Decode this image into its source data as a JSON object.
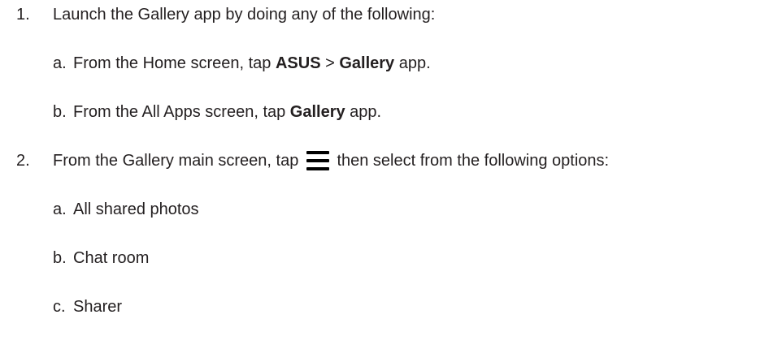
{
  "steps": [
    {
      "num": "1.",
      "text": "Launch the Gallery app by doing any of the following:",
      "substeps": [
        {
          "letter": "a.",
          "pre": "From the Home screen, tap ",
          "bold1": "ASUS",
          "mid": " > ",
          "bold2": "Gallery",
          "post": " app."
        },
        {
          "letter": "b.",
          "pre": "From the All Apps screen, tap ",
          "bold1": "Gallery",
          "post": " app."
        }
      ]
    },
    {
      "num": "2.",
      "pre": "From the Gallery main screen, tap ",
      "icon": "menu-icon",
      "post": " then select from the following options:",
      "substeps": [
        {
          "letter": "a.",
          "text": "All shared photos"
        },
        {
          "letter": "b.",
          "text": "Chat room"
        },
        {
          "letter": "c.",
          "text": "Sharer"
        }
      ]
    }
  ]
}
